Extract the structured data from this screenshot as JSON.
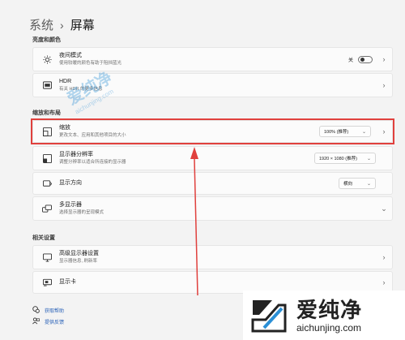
{
  "breadcrumb": {
    "parent": "系统",
    "separator": "›",
    "current": "屏幕"
  },
  "sections": {
    "brightness_color": "亮度和颜色",
    "scale_layout": "缩放和布局",
    "related": "相关设置"
  },
  "night_mode": {
    "title": "夜间模式",
    "desc": "使用较暖的颜色有助于阻挡蓝光",
    "state_label": "关"
  },
  "hdr": {
    "title": "HDR",
    "desc": "有关 HDR 的更多信息"
  },
  "scale": {
    "title": "缩放",
    "desc": "更改文本、应用和其他项目的大小",
    "value": "100% (推荐)"
  },
  "resolution": {
    "title": "显示器分辨率",
    "desc": "调整分辨率以适合所连接的显示器",
    "value": "1920 × 1080 (推荐)"
  },
  "orientation": {
    "title": "显示方向",
    "value": "横向"
  },
  "multi_display": {
    "title": "多显示器",
    "desc": "选择显示器的呈现模式"
  },
  "advanced_display": {
    "title": "高级显示器设置",
    "desc": "显示器信息, 刷新率"
  },
  "graphics": {
    "title": "显示卡"
  },
  "links": {
    "help": "获取帮助",
    "feedback": "提供反馈"
  },
  "watermark": {
    "big": "爱纯净",
    "small": "aichunjing.com"
  },
  "brand": {
    "cn": "爱纯净",
    "url": "aichunjing.com"
  },
  "colors": {
    "highlight": "#e0403d",
    "link": "#2a62b8",
    "brand_blue": "#2a8fd6"
  }
}
